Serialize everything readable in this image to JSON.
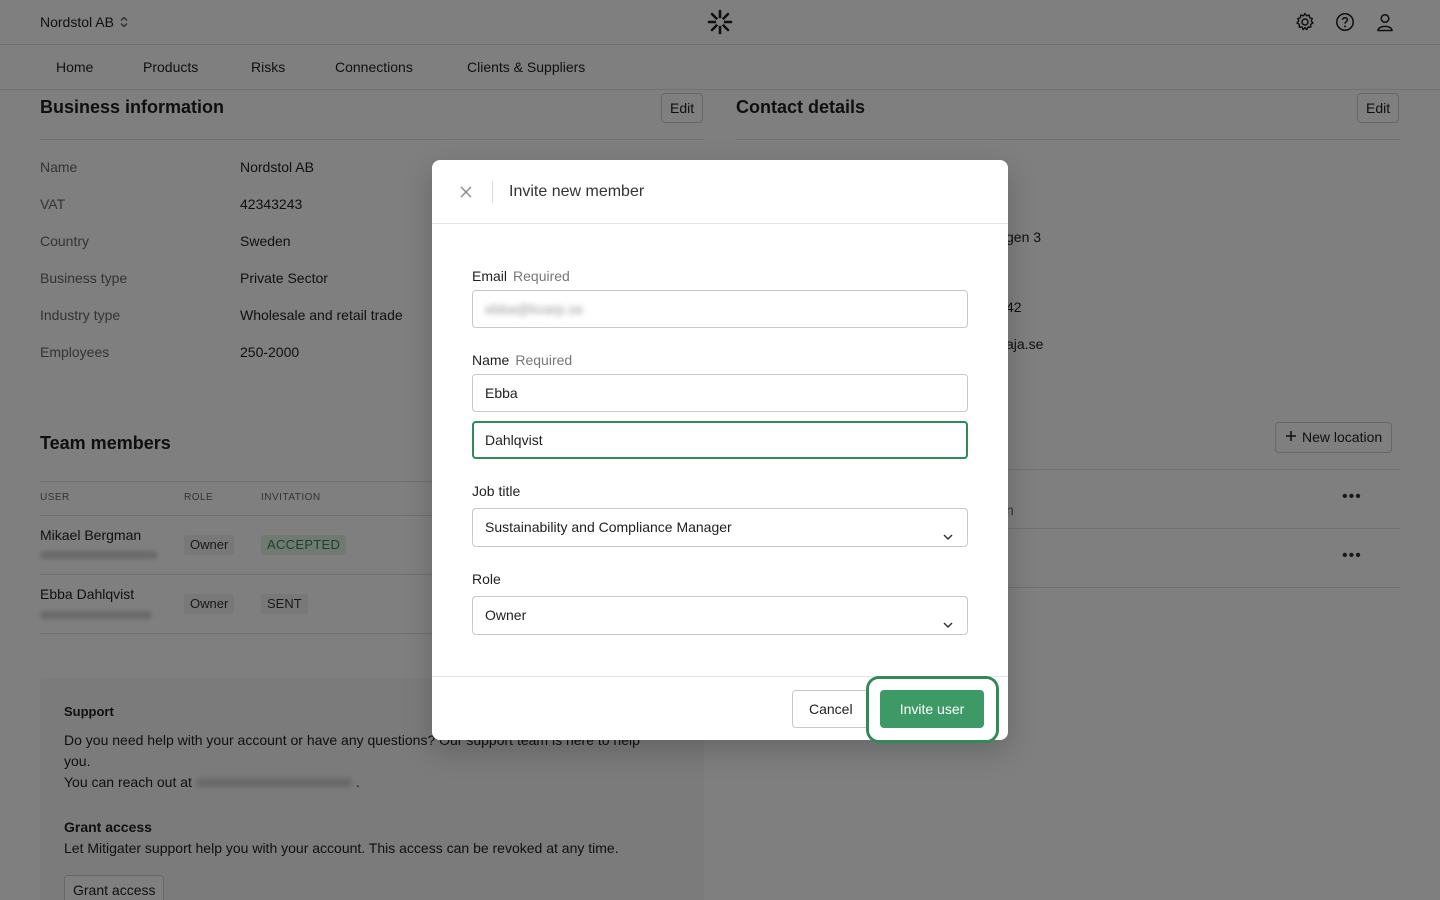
{
  "header": {
    "org_name": "Nordstol AB",
    "icons": [
      "settings-icon",
      "help-icon",
      "user-icon"
    ]
  },
  "nav": {
    "items": [
      "Home",
      "Products",
      "Risks",
      "Connections",
      "Clients & Suppliers"
    ]
  },
  "business": {
    "title": "Business information",
    "edit_label": "Edit",
    "rows": [
      {
        "label": "Name",
        "value": "Nordstol AB"
      },
      {
        "label": "VAT",
        "value": "42343243"
      },
      {
        "label": "Country",
        "value": "Sweden"
      },
      {
        "label": "Business type",
        "value": "Private Sector"
      },
      {
        "label": "Industry type",
        "value": "Wholesale and retail trade"
      },
      {
        "label": "Employees",
        "value": "250-2000"
      }
    ]
  },
  "contact": {
    "title": "Contact details",
    "edit_label": "Edit",
    "partials": [
      "gen 3",
      "42",
      "aja.se"
    ]
  },
  "locations": {
    "new_location_label": "New location",
    "partial_row": "n"
  },
  "team": {
    "title": "Team members",
    "columns": [
      "User",
      "Role",
      "Invitation"
    ],
    "members": [
      {
        "name": "Mikael Bergman",
        "role": "Owner",
        "invitation": "ACCEPTED"
      },
      {
        "name": "Ebba Dahlqvist",
        "role": "Owner",
        "invitation": "SENT"
      }
    ]
  },
  "support": {
    "title": "Support",
    "line1": "Do you need help with your account or have any questions? Our support team is here to help",
    "line2": "you.",
    "line3_prefix": "You can reach out at",
    "line3_suffix": ".",
    "grant_title": "Grant access",
    "grant_text": "Let Mitigater support help you with your account. This access can be revoked at any time.",
    "grant_button": "Grant access"
  },
  "modal": {
    "title": "Invite new member",
    "email_label": "Email",
    "required": "Required",
    "email_value": "ebba@kvarp.se",
    "name_label": "Name",
    "first_name": "Ebba",
    "last_name": "Dahlqvist",
    "job_title_label": "Job title",
    "job_title_value": "Sustainability and Compliance Manager",
    "role_label": "Role",
    "role_value": "Owner",
    "cancel_label": "Cancel",
    "invite_label": "Invite user"
  },
  "colors": {
    "accent": "#3d9a66",
    "badge_green_bg": "#e0f3e5",
    "badge_green_text": "#2d8a4a"
  }
}
